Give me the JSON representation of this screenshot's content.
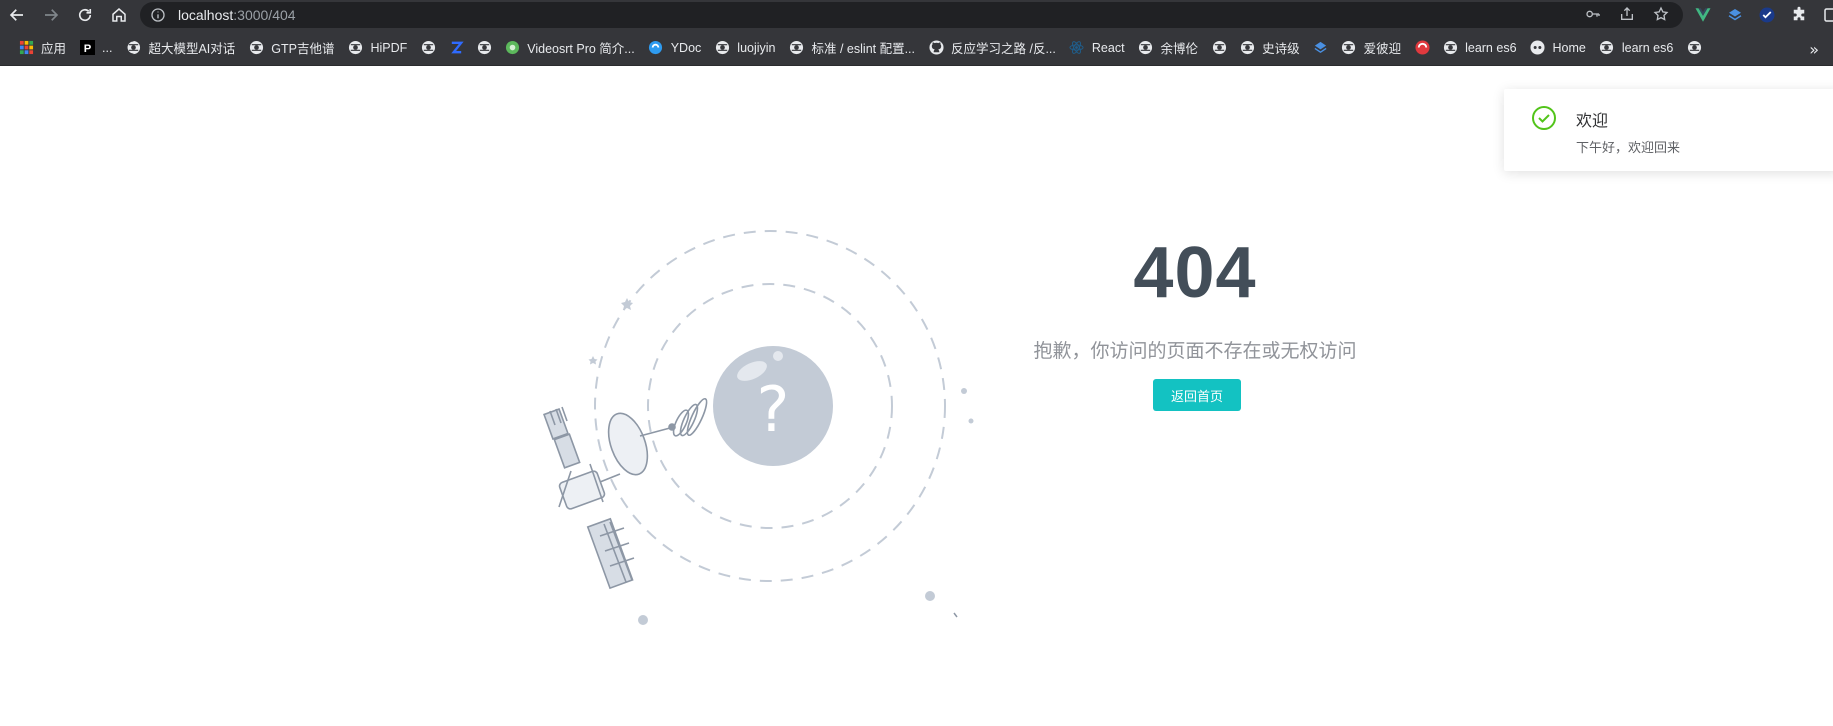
{
  "browser": {
    "url_host": "localhost",
    "url_path": ":3000/404"
  },
  "bookmarks": [
    {
      "label": "应用",
      "icon": "apps-grid-icon"
    },
    {
      "label": "...",
      "icon": "p-logo-icon"
    },
    {
      "label": "超大模型AI对话",
      "icon": "globe-icon"
    },
    {
      "label": "GTP吉他谱",
      "icon": "globe-icon"
    },
    {
      "label": "HiPDF",
      "icon": "globe-icon"
    },
    {
      "label": "",
      "icon": "globe-icon"
    },
    {
      "label": "",
      "icon": "z-logo-icon"
    },
    {
      "label": "",
      "icon": "globe-icon"
    },
    {
      "label": "Videosrt Pro 简介...",
      "icon": "green-logo-icon"
    },
    {
      "label": "YDoc",
      "icon": "ydoc-logo-icon"
    },
    {
      "label": "luojiyin",
      "icon": "globe-icon"
    },
    {
      "label": "标准 / eslint 配置...",
      "icon": "globe-icon"
    },
    {
      "label": "反应学习之路 /反...",
      "icon": "github-icon"
    },
    {
      "label": "React",
      "icon": "react-icon"
    },
    {
      "label": "余博伦",
      "icon": "globe-icon"
    },
    {
      "label": "",
      "icon": "globe-icon"
    },
    {
      "label": "史诗级",
      "icon": "globe-icon"
    },
    {
      "label": "",
      "icon": "layers-icon"
    },
    {
      "label": "爱彼迎",
      "icon": "globe-icon"
    },
    {
      "label": "",
      "icon": "red-circle-icon"
    },
    {
      "label": "learn es6",
      "icon": "globe-icon"
    },
    {
      "label": "Home",
      "icon": "face-logo-icon"
    },
    {
      "label": "learn es6",
      "icon": "globe-icon"
    },
    {
      "label": "",
      "icon": "globe-icon"
    }
  ],
  "page": {
    "error_code": "404",
    "error_description": "抱歉，你访问的页面不存在或无权访问",
    "back_button_label": "返回首页"
  },
  "notification": {
    "title": "欢迎",
    "message": "下午好，欢迎回来"
  },
  "colors": {
    "accent_button": "#13c2c2",
    "success_check": "#52c41a",
    "illustration": "#c3cbd6",
    "chrome": "#35363a"
  }
}
